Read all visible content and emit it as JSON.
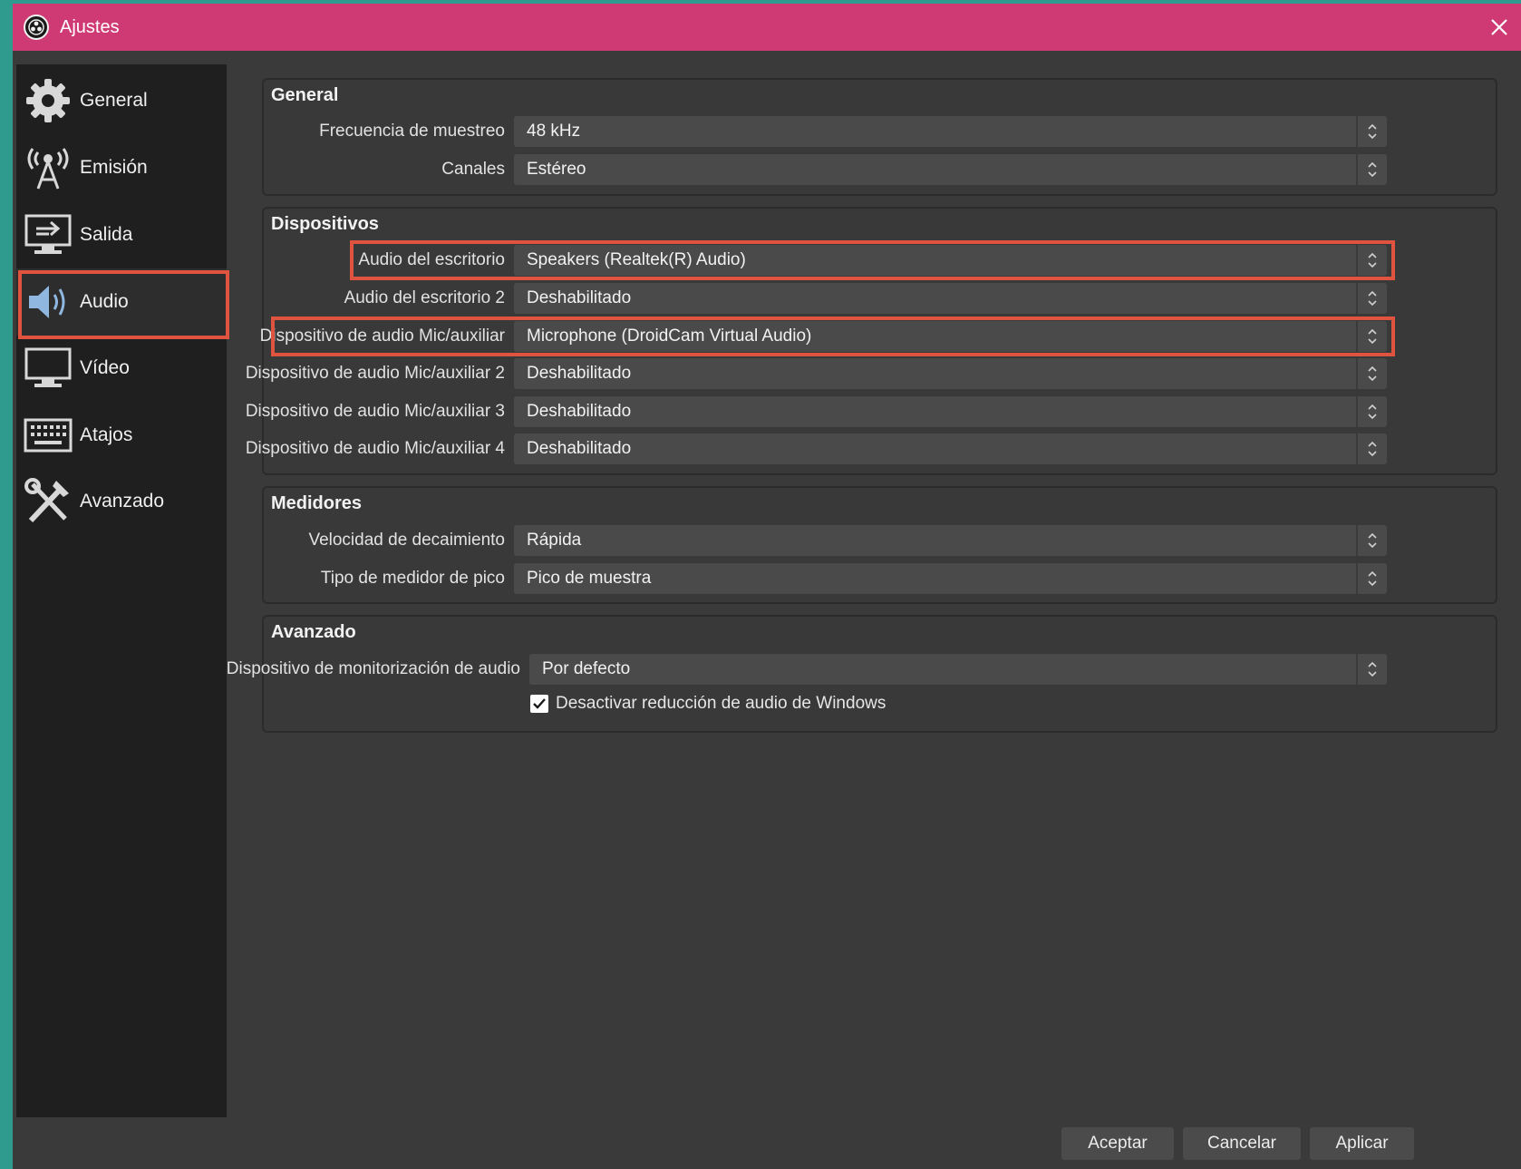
{
  "window": {
    "title": "Ajustes"
  },
  "sidebar": {
    "items": [
      {
        "label": "General",
        "icon": "gear-icon"
      },
      {
        "label": "Emisión",
        "icon": "broadcast-antenna-icon"
      },
      {
        "label": "Salida",
        "icon": "output-monitor-icon"
      },
      {
        "label": "Audio",
        "icon": "speaker-icon",
        "active": true
      },
      {
        "label": "Vídeo",
        "icon": "monitor-icon"
      },
      {
        "label": "Atajos",
        "icon": "keyboard-icon"
      },
      {
        "label": "Avanzado",
        "icon": "tools-icon"
      }
    ]
  },
  "general": {
    "title": "General",
    "rows": [
      {
        "label": "Frecuencia de muestreo",
        "value": "48 kHz"
      },
      {
        "label": "Canales",
        "value": "Estéreo"
      }
    ]
  },
  "devices": {
    "title": "Dispositivos",
    "rows": [
      {
        "label": "Audio del escritorio",
        "value": "Speakers (Realtek(R) Audio)"
      },
      {
        "label": "Audio del escritorio 2",
        "value": "Deshabilitado"
      },
      {
        "label": "Dispositivo de audio Mic/auxiliar",
        "value": "Microphone (DroidCam Virtual Audio)"
      },
      {
        "label": "Dispositivo de audio Mic/auxiliar 2",
        "value": "Deshabilitado"
      },
      {
        "label": "Dispositivo de audio Mic/auxiliar 3",
        "value": "Deshabilitado"
      },
      {
        "label": "Dispositivo de audio Mic/auxiliar 4",
        "value": "Deshabilitado"
      }
    ]
  },
  "meters": {
    "title": "Medidores",
    "rows": [
      {
        "label": "Velocidad de decaimiento",
        "value": "Rápida"
      },
      {
        "label": "Tipo de medidor de pico",
        "value": "Pico de muestra"
      }
    ]
  },
  "advanced": {
    "title": "Avanzado",
    "monitoring_label": "Dispositivo de monitorización de audio",
    "monitoring_value": "Por defecto",
    "ducking_label": "Desactivar reducción de audio de Windows",
    "ducking_checked": true
  },
  "buttons": {
    "accept": "Aceptar",
    "cancel": "Cancelar",
    "apply": "Aplicar"
  },
  "colors": {
    "titlebar": "#cf3a74",
    "highlight": "#e0533e",
    "background": "#3a3a3a",
    "sidebar": "#1f1f1f"
  }
}
